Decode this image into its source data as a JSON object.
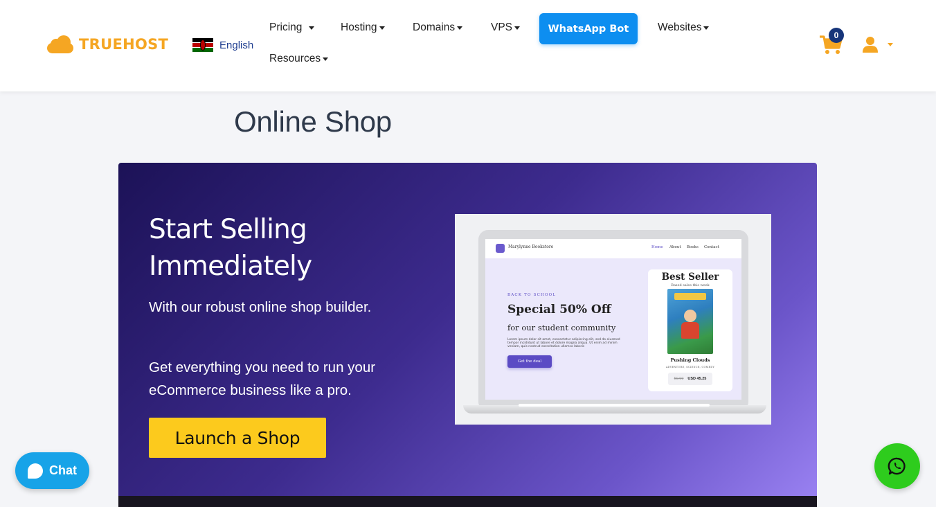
{
  "brand": {
    "name": "TRUEHOST",
    "color": "#f5a623",
    "icon": "cloud-icon"
  },
  "language": {
    "label": "English",
    "flag": "kenya-flag-icon"
  },
  "nav": {
    "pricing": "Pricing",
    "hosting": "Hosting",
    "domains": "Domains",
    "vps": "VPS",
    "whatsapp_bot": "WhatsApp Bot",
    "websites": "Websites",
    "resources": "Resources"
  },
  "cart": {
    "count": "0",
    "icon": "cart-icon"
  },
  "user": {
    "icon": "user-icon"
  },
  "page": {
    "title": "Online Shop"
  },
  "hero": {
    "title": "Start Selling Immediately",
    "paragraph1": "With our robust online shop builder.",
    "paragraph2": "Get everything you need to run your eCommerce business like a pro.",
    "cta": "Launch a Shop"
  },
  "mockup": {
    "brand": "Marylynne Bookstore",
    "nav": [
      "Home",
      "About",
      "Books",
      "Contact"
    ],
    "kicker": "BACK TO SCHOOL",
    "headline": "Special 50% Off",
    "subheadline": "for our student community",
    "body": "Lorem ipsum dolor sit amet, consectetur adipiscing elit, sed do eiusmod tempor incididunt ut labore et dolore magna aliqua. Ut enim ad minim veniam, quis nostrud exercitation ullamco laboris",
    "button": "Get the deal",
    "card_title": "Best Seller",
    "card_subtitle": "Based sales this week",
    "book_title": "Pushing Clouds",
    "book_tags": "ADVENTURE, SCIENCE, COMEDY",
    "old_price": "59.00",
    "new_price": "USD 45.25"
  },
  "chat": {
    "label": "Chat",
    "icon": "chat-bubble-icon"
  },
  "whatsapp": {
    "icon": "whatsapp-icon"
  },
  "colors": {
    "accent": "#0d8ef0",
    "cta": "#fcca1d",
    "chat": "#17a3e8",
    "whatsapp": "#2ecc1d",
    "hero_start": "#1c1257",
    "hero_end": "#9b83f3"
  }
}
